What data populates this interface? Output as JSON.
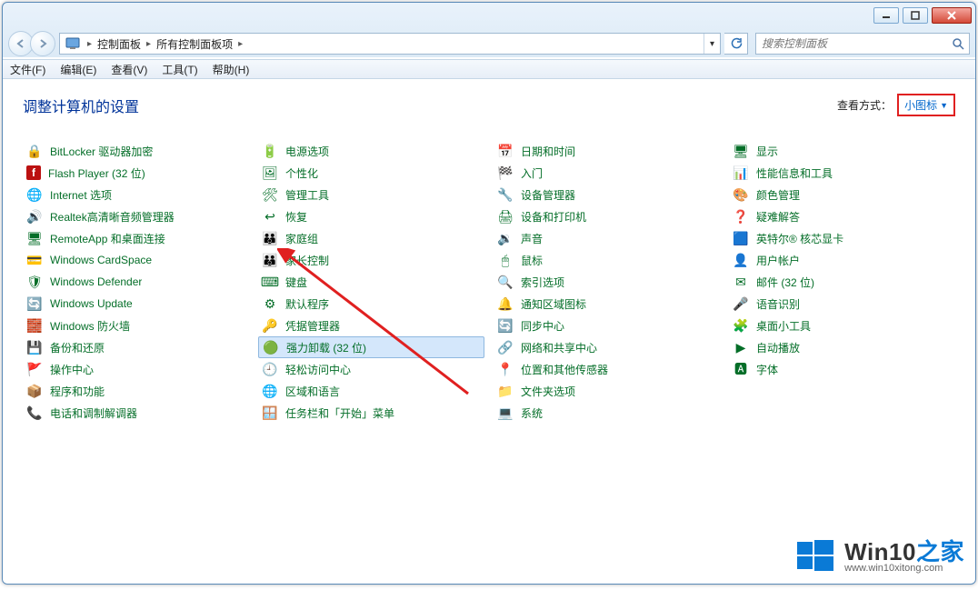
{
  "breadcrumbs": {
    "root": "控制面板",
    "current": "所有控制面板项"
  },
  "search": {
    "placeholder": "搜索控制面板"
  },
  "menu": {
    "file": "文件(F)",
    "edit": "编辑(E)",
    "view": "查看(V)",
    "tools": "工具(T)",
    "help": "帮助(H)"
  },
  "heading": "调整计算机的设置",
  "viewby": {
    "label": "查看方式：",
    "mode": "小图标"
  },
  "items": [
    {
      "name": "bitlocker",
      "label": "BitLocker 驱动器加密",
      "ico": "🔒",
      "bg": ""
    },
    {
      "name": "flash",
      "label": "Flash Player (32 位)",
      "ico": "f",
      "bg": "#b11"
    },
    {
      "name": "internet",
      "label": "Internet 选项",
      "ico": "🌐",
      "bg": ""
    },
    {
      "name": "realtek",
      "label": "Realtek高清晰音频管理器",
      "ico": "🔊",
      "bg": ""
    },
    {
      "name": "remoteapp",
      "label": "RemoteApp 和桌面连接",
      "ico": "🖥",
      "bg": ""
    },
    {
      "name": "cardspace",
      "label": "Windows CardSpace",
      "ico": "💳",
      "bg": ""
    },
    {
      "name": "defender",
      "label": "Windows Defender",
      "ico": "🛡",
      "bg": ""
    },
    {
      "name": "update",
      "label": "Windows Update",
      "ico": "🔄",
      "bg": ""
    },
    {
      "name": "firewall",
      "label": "Windows 防火墙",
      "ico": "🧱",
      "bg": ""
    },
    {
      "name": "backup",
      "label": "备份和还原",
      "ico": "💾",
      "bg": ""
    },
    {
      "name": "action-center",
      "label": "操作中心",
      "ico": "🚩",
      "bg": ""
    },
    {
      "name": "programs",
      "label": "程序和功能",
      "ico": "📦",
      "bg": ""
    },
    {
      "name": "phone-modem",
      "label": "电话和调制解调器",
      "ico": "📞",
      "bg": ""
    },
    {
      "name": "power",
      "label": "电源选项",
      "ico": "🔋",
      "bg": ""
    },
    {
      "name": "personalize",
      "label": "个性化",
      "ico": "🖼",
      "bg": ""
    },
    {
      "name": "admin-tools",
      "label": "管理工具",
      "ico": "🛠",
      "bg": ""
    },
    {
      "name": "recovery",
      "label": "恢复",
      "ico": "↩",
      "bg": ""
    },
    {
      "name": "homegroup",
      "label": "家庭组",
      "ico": "👪",
      "bg": ""
    },
    {
      "name": "parental",
      "label": "家长控制",
      "ico": "👪",
      "bg": ""
    },
    {
      "name": "keyboard",
      "label": "键盘",
      "ico": "⌨",
      "bg": ""
    },
    {
      "name": "default-prog",
      "label": "默认程序",
      "ico": "⚙",
      "bg": ""
    },
    {
      "name": "credential",
      "label": "凭据管理器",
      "ico": "🔑",
      "bg": ""
    },
    {
      "name": "force-uninst",
      "label": "强力卸载 (32 位)",
      "ico": "🟢",
      "bg": "",
      "selected": true
    },
    {
      "name": "ease-access",
      "label": "轻松访问中心",
      "ico": "🕘",
      "bg": ""
    },
    {
      "name": "region-lang",
      "label": "区域和语言",
      "ico": "🌐",
      "bg": ""
    },
    {
      "name": "taskbar",
      "label": "任务栏和「开始」菜单",
      "ico": "🪟",
      "bg": ""
    },
    {
      "name": "date-time",
      "label": "日期和时间",
      "ico": "📅",
      "bg": ""
    },
    {
      "name": "get-started",
      "label": "入门",
      "ico": "🏁",
      "bg": ""
    },
    {
      "name": "device-mgr",
      "label": "设备管理器",
      "ico": "🔧",
      "bg": ""
    },
    {
      "name": "devices-print",
      "label": "设备和打印机",
      "ico": "🖨",
      "bg": ""
    },
    {
      "name": "sound",
      "label": "声音",
      "ico": "🔉",
      "bg": ""
    },
    {
      "name": "mouse",
      "label": "鼠标",
      "ico": "🖱",
      "bg": ""
    },
    {
      "name": "indexing",
      "label": "索引选项",
      "ico": "🔍",
      "bg": ""
    },
    {
      "name": "notif-icons",
      "label": "通知区域图标",
      "ico": "🔔",
      "bg": ""
    },
    {
      "name": "sync-center",
      "label": "同步中心",
      "ico": "🔄",
      "bg": ""
    },
    {
      "name": "network-share",
      "label": "网络和共享中心",
      "ico": "🔗",
      "bg": ""
    },
    {
      "name": "loc-sensors",
      "label": "位置和其他传感器",
      "ico": "📍",
      "bg": ""
    },
    {
      "name": "folder-opt",
      "label": "文件夹选项",
      "ico": "📁",
      "bg": ""
    },
    {
      "name": "system",
      "label": "系统",
      "ico": "💻",
      "bg": ""
    },
    {
      "name": "display",
      "label": "显示",
      "ico": "🖥",
      "bg": ""
    },
    {
      "name": "perf-info",
      "label": "性能信息和工具",
      "ico": "📊",
      "bg": ""
    },
    {
      "name": "color-mgmt",
      "label": "颜色管理",
      "ico": "🎨",
      "bg": ""
    },
    {
      "name": "troubleshoot",
      "label": "疑难解答",
      "ico": "❓",
      "bg": ""
    },
    {
      "name": "intel-gfx",
      "label": "英特尔® 核芯显卡",
      "ico": "🟦",
      "bg": ""
    },
    {
      "name": "user-acct",
      "label": "用户帐户",
      "ico": "👤",
      "bg": ""
    },
    {
      "name": "mail",
      "label": "邮件 (32 位)",
      "ico": "✉",
      "bg": ""
    },
    {
      "name": "speech",
      "label": "语音识别",
      "ico": "🎤",
      "bg": ""
    },
    {
      "name": "gadgets",
      "label": "桌面小工具",
      "ico": "🧩",
      "bg": ""
    },
    {
      "name": "autoplay",
      "label": "自动播放",
      "ico": "▶",
      "bg": ""
    },
    {
      "name": "fonts",
      "label": "字体",
      "ico": "🅰",
      "bg": ""
    }
  ],
  "watermark": {
    "brand": "Win10",
    "suffix": "之家",
    "url": "www.win10xitong.com"
  }
}
